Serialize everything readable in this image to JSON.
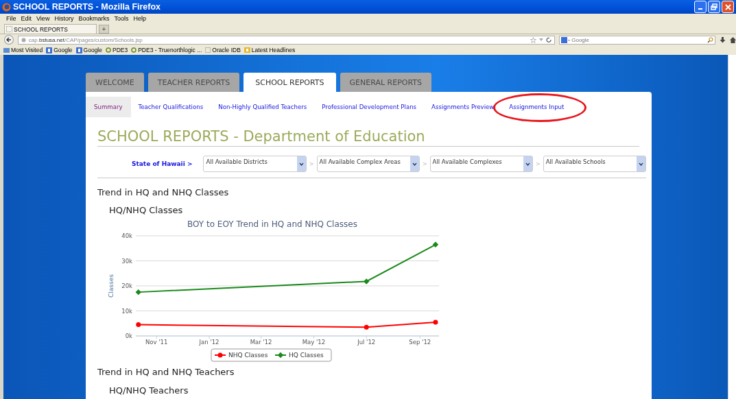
{
  "window": {
    "title": "SCHOOL REPORTS - Mozilla Firefox"
  },
  "menu": [
    "File",
    "Edit",
    "View",
    "History",
    "Bookmarks",
    "Tools",
    "Help"
  ],
  "browser_tabs": [
    {
      "label": "SCHOOL REPORTS",
      "selected": true
    }
  ],
  "new_tab": "+",
  "address_bar": {
    "url": "cap.**bstusa.net**/CAP/pages/custom/Schools.jsp"
  },
  "search_bar": {
    "placeholder": "Google"
  },
  "bookmarks": [
    {
      "label": "Most Visited",
      "kind": "folder"
    },
    {
      "label": "Google",
      "kind": "google"
    },
    {
      "label": "Google",
      "kind": "google"
    },
    {
      "label": "PDE3",
      "kind": "site"
    },
    {
      "label": "PDE3 - Truenorthlogic ...",
      "kind": "site"
    },
    {
      "label": "Oracle IDB",
      "kind": "page"
    },
    {
      "label": "Latest Headlines",
      "kind": "feed"
    }
  ],
  "tabs": [
    {
      "label": "WELCOME",
      "selected": false
    },
    {
      "label": "TEACHER REPORTS",
      "selected": false
    },
    {
      "label": "SCHOOL REPORTS",
      "selected": true
    },
    {
      "label": "GENERAL REPORTS",
      "selected": false
    }
  ],
  "subnav": [
    {
      "label": "Summary",
      "selected": true,
      "circled": false
    },
    {
      "label": "Teacher Qualifications",
      "selected": false,
      "circled": false
    },
    {
      "label": "Non-Highly Qualified Teachers",
      "selected": false,
      "circled": false
    },
    {
      "label": "Professional Development Plans",
      "selected": false,
      "circled": false
    },
    {
      "label": "Assignments Preview",
      "selected": false,
      "circled": false
    },
    {
      "label": "Assignments Input",
      "selected": false,
      "circled": true
    }
  ],
  "page_title": "SCHOOL REPORTS - Department of Education",
  "filters": {
    "root": "State of Hawaii >",
    "separator": ">",
    "dropdowns": [
      "All Available Districts",
      "All Available Complex Areas",
      "All Available Complexes",
      "All Available Schools"
    ]
  },
  "sections": [
    {
      "heading": "Trend in HQ and NHQ Classes",
      "subheading": "HQ/NHQ Classes",
      "chart_data": {
        "type": "line",
        "title": "BOY to EOY Trend in HQ and NHQ Classes",
        "ylabel": "Classes",
        "grid": true,
        "legend": "bottom",
        "x": [
          "2011-10-11",
          "2012-07-01",
          "2012-09-19"
        ],
        "xlim": [
          "2011-10-08",
          "2012-09-23"
        ],
        "ylim": [
          0,
          40000
        ],
        "xticks": [
          {
            "value": "2011-11-01",
            "label": "Nov '11"
          },
          {
            "value": "2012-01-01",
            "label": "Jan '12"
          },
          {
            "value": "2012-03-01",
            "label": "Mar '12"
          },
          {
            "value": "2012-05-01",
            "label": "May '12"
          },
          {
            "value": "2012-07-01",
            "label": "Jul '12"
          },
          {
            "value": "2012-09-01",
            "label": "Sep '12"
          }
        ],
        "yticks": [
          {
            "value": 0,
            "label": "0k"
          },
          {
            "value": 10000,
            "label": "10k"
          },
          {
            "value": 20000,
            "label": "20k"
          },
          {
            "value": 30000,
            "label": "30k"
          },
          {
            "value": 40000,
            "label": "40k"
          }
        ],
        "series": [
          {
            "name": "NHQ Classes",
            "color": "#ff0000",
            "marker": "circle",
            "values": [
              4500,
              3500,
              5500
            ]
          },
          {
            "name": "HQ Classes",
            "color": "#1a8a1a",
            "marker": "diamond",
            "values": [
              17500,
              21800,
              36500
            ]
          }
        ]
      }
    },
    {
      "heading": "Trend in HQ and NHQ Teachers",
      "subheading": "HQ/NHQ Teachers"
    }
  ]
}
